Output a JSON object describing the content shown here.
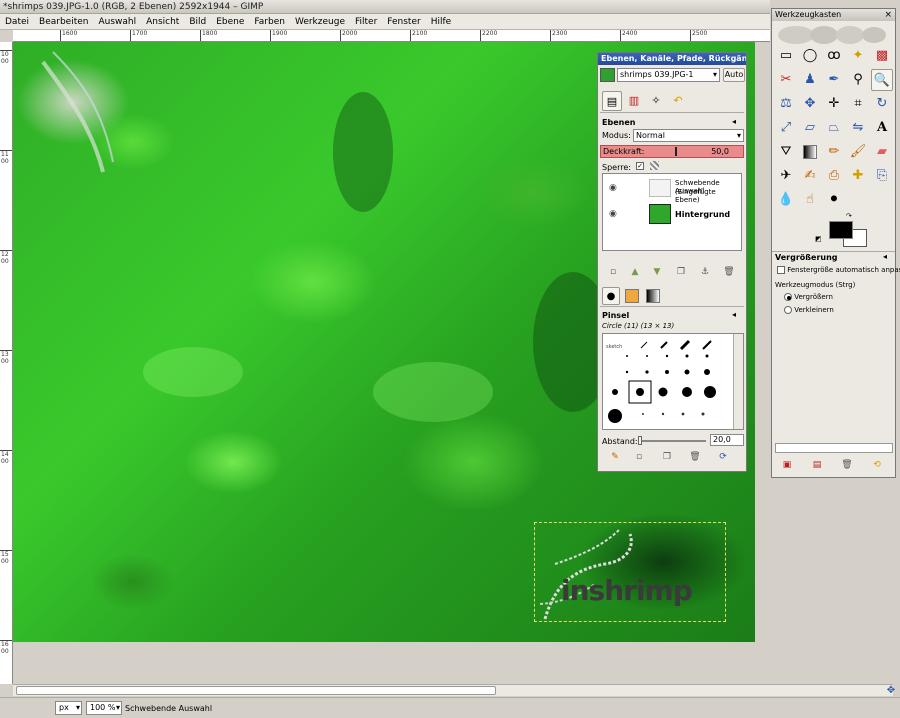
{
  "window": {
    "title": "*shrimps 039.JPG-1.0 (RGB, 2 Ebenen) 2592x1944 – GIMP"
  },
  "menu": [
    "Datei",
    "Bearbeiten",
    "Auswahl",
    "Ansicht",
    "Bild",
    "Ebene",
    "Farben",
    "Werkzeuge",
    "Filter",
    "Fenster",
    "Hilfe"
  ],
  "ruler": {
    "h_ticks": [
      "1600",
      "1700",
      "1800",
      "1900",
      "2000",
      "2100",
      "2200",
      "2300",
      "2400",
      "2500"
    ],
    "v_ticks": [
      "1000",
      "1100",
      "1200",
      "1300",
      "1400",
      "1500",
      "1600"
    ]
  },
  "logo": {
    "text": "inshrimp"
  },
  "status": {
    "unit": "px",
    "zoom": "100 %",
    "message": "Schwebende Auswahl"
  },
  "dock": {
    "title": "Ebenen, Kanäle, Pfade, Rückgäng…",
    "image_select": "shrimps 039.JPG-1",
    "auto_label": "Auto",
    "layers": {
      "header": "Ebenen",
      "mode_label": "Modus:",
      "mode_value": "Normal",
      "opacity_label": "Deckkraft:",
      "opacity_value": "50,0",
      "opacity_fraction": 0.5,
      "lock_label": "Sperre:",
      "items": [
        {
          "name": "Schwebende Auswahl",
          "sub": "(Eingefügte Ebene)"
        },
        {
          "name": "Hintergrund",
          "sub": ""
        }
      ]
    },
    "brushes": {
      "header": "Pinsel",
      "current": "Circle (11) (13 × 13)",
      "spacing_label": "Abstand:",
      "spacing_value": "20,0"
    }
  },
  "toolbox": {
    "title": "Werkzeugkasten",
    "options_header": "Vergrößerung",
    "auto_resize": "Fenstergröße automatisch anpassen",
    "mode_label": "Werkzeugmodus (Strg)",
    "mode_in": "Vergrößern",
    "mode_out": "Verkleinern"
  },
  "colors": {
    "fg": "#000000",
    "bg": "#ffffff",
    "accent": "#2a55a8",
    "opacity_bar": "#e88a8a"
  }
}
